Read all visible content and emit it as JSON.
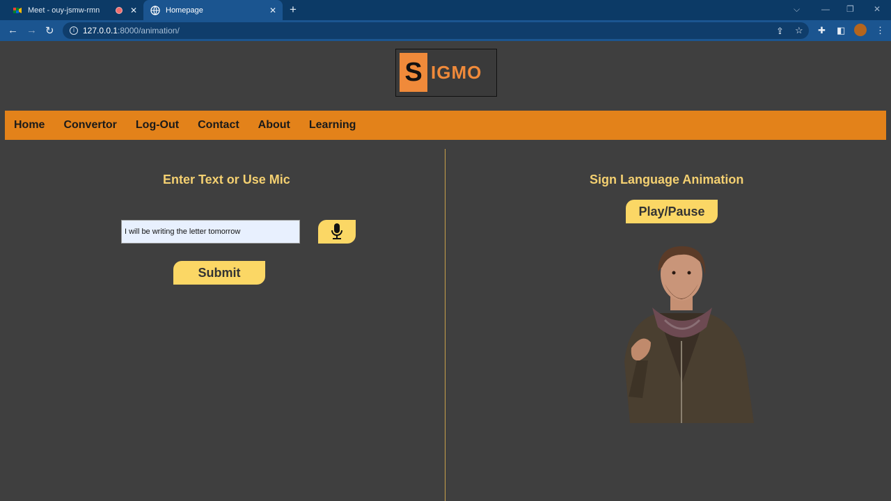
{
  "browser": {
    "tabs": [
      {
        "title": "Meet - ouy-jsmw-rmn",
        "active": false
      },
      {
        "title": "Homepage",
        "active": true
      }
    ],
    "url_host": "127.0.0.1",
    "url_rest": ":8000/animation/"
  },
  "logo": {
    "first_letter": "S",
    "rest": "IGMO"
  },
  "nav": {
    "items": [
      "Home",
      "Convertor",
      "Log-Out",
      "Contact",
      "About",
      "Learning"
    ]
  },
  "left_panel": {
    "heading": "Enter Text or Use Mic",
    "input_value": "I will be writing the letter tomorrow",
    "submit_label": "Submit"
  },
  "right_panel": {
    "heading": "Sign Language Animation",
    "play_label": "Play/Pause"
  },
  "colors": {
    "page_bg": "#3f3f3f",
    "nav_bg": "#e3821a",
    "button_bg": "#fbd765",
    "heading": "#f4d071",
    "browser_frame": "#0c3a66"
  }
}
